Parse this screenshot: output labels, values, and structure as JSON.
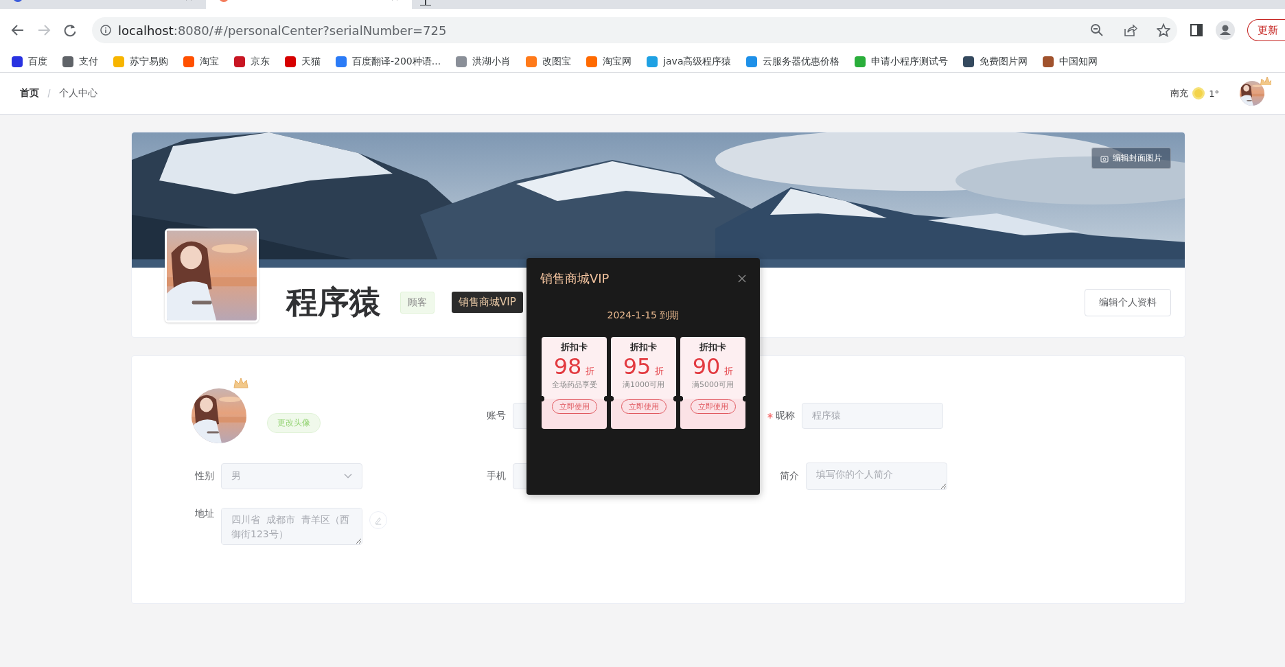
{
  "browser": {
    "tabs": [
      {
        "selected": false
      },
      {
        "selected": true
      }
    ],
    "url_host": "localhost",
    "url_rest": ":8080/#/personalCenter?serialNumber=725",
    "update_button": "更新",
    "bookmarks": [
      {
        "label": "百度",
        "color": "#2932e1"
      },
      {
        "label": "支付",
        "color": "#5f6368"
      },
      {
        "label": "苏宁易购",
        "color": "#f7b500"
      },
      {
        "label": "淘宝",
        "color": "#ff5000"
      },
      {
        "label": "京东",
        "color": "#c81623"
      },
      {
        "label": "天猫",
        "color": "#d60000"
      },
      {
        "label": "百度翻译-200种语...",
        "color": "#2b7bf6"
      },
      {
        "label": "洪湖小肖",
        "color": "#8a8f98"
      },
      {
        "label": "改图宝",
        "color": "#ff7a1a"
      },
      {
        "label": "淘宝网",
        "color": "#ff6a00"
      },
      {
        "label": "java高级程序猿",
        "color": "#1fa1e3"
      },
      {
        "label": "云服务器优惠价格",
        "color": "#1e90e8"
      },
      {
        "label": "申请小程序测试号",
        "color": "#2aae3b"
      },
      {
        "label": "免费图片网",
        "color": "#34495e"
      },
      {
        "label": "中国知网",
        "color": "#a0522d"
      }
    ]
  },
  "header": {
    "breadcrumb": [
      "首页",
      "个人中心"
    ],
    "city": "南充",
    "temperature": "1°"
  },
  "cover": {
    "edit_cover": "编辑封面图片",
    "name": "程序猿",
    "role_tag": "顾客",
    "vip_tag": "销售商城VIP",
    "edit_button": "编辑个人资料"
  },
  "form": {
    "change_avatar": "更改头像",
    "fields": [
      {
        "label": "账号",
        "kind": "input",
        "required": false,
        "disabled": true
      },
      {
        "label": "昵称",
        "kind": "input",
        "required": true,
        "disabled": true,
        "value": "程序猿"
      },
      {
        "label": "性别",
        "kind": "select",
        "required": false,
        "disabled": true,
        "value": "男"
      },
      {
        "label": "手机",
        "kind": "input",
        "required": false,
        "disabled": true
      },
      {
        "label": "简介",
        "kind": "textarea",
        "required": false,
        "disabled": true,
        "placeholder": "填写你的个人简介"
      },
      {
        "label": "地址",
        "kind": "textarea",
        "required": false,
        "disabled": true,
        "value": "四川省  成都市  青羊区（西御街123号）",
        "editable": true
      }
    ]
  },
  "modal": {
    "title": "销售商城VIP",
    "expiry": "2024-1-15 到期",
    "cards": [
      {
        "title": "折扣卡",
        "discount": "98",
        "unit": "折",
        "condition": "全场药品享受",
        "button": "立即使用"
      },
      {
        "title": "折扣卡",
        "discount": "95",
        "unit": "折",
        "condition": "满1000可用",
        "button": "立即使用"
      },
      {
        "title": "折扣卡",
        "discount": "90",
        "unit": "折",
        "condition": "满5000可用",
        "button": "立即使用"
      }
    ]
  }
}
